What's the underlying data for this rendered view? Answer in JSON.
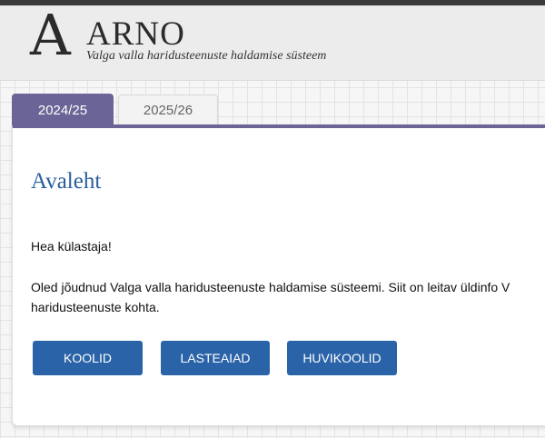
{
  "header": {
    "logo_letter": "A",
    "app_name": "ARNO",
    "subtitle": "Valga valla haridusteenuste haldamise süsteem"
  },
  "tabs": [
    {
      "label": "2024/25",
      "active": true
    },
    {
      "label": "2025/26",
      "active": false
    }
  ],
  "main": {
    "title": "Avaleht",
    "greeting": "Hea külastaja!",
    "intro_line1": "Oled jõudnud Valga valla haridusteenuste haldamise süsteemi. Siit on leitav üldinfo V",
    "intro_line2": "haridusteenuste kohta."
  },
  "buttons": {
    "schools": "KOOLID",
    "kindergartens": "LASTEAIAD",
    "hobby_schools": "HUVIKOOLID"
  },
  "colors": {
    "accent": "#6a6596",
    "button": "#2a63a8",
    "title": "#2a5f9e"
  }
}
